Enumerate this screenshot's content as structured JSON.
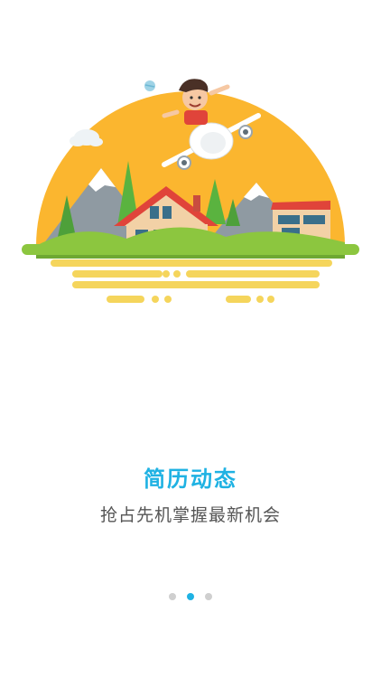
{
  "guide": {
    "title": "简历动态",
    "subtitle": "抢占先机掌握最新机会",
    "illustration_icon": "travel-house-plane-illustration",
    "page_count": 3,
    "current_page": 2
  },
  "colors": {
    "accent": "#1fb2e3",
    "subtitle_text": "#555555",
    "dot_inactive": "#cfcfcf",
    "sun": "#fbb62f",
    "grass": "#8cc63f",
    "ground_lines": "#f5d55c"
  }
}
